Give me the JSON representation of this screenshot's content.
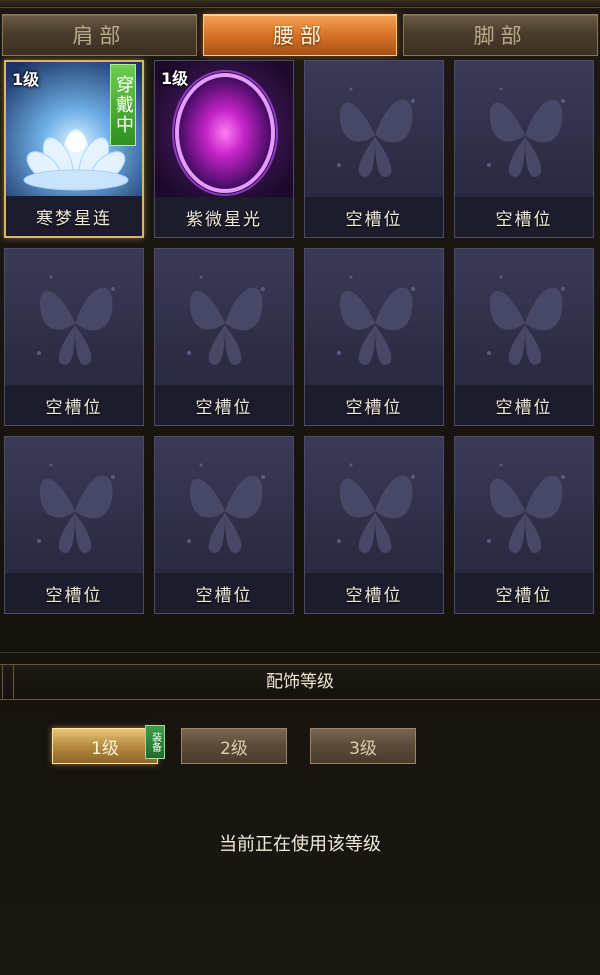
{
  "tabs": [
    {
      "label": "肩部",
      "active": false
    },
    {
      "label": "腰部",
      "active": true
    },
    {
      "label": "脚部",
      "active": false
    }
  ],
  "slots": [
    {
      "name": "寒梦星连",
      "level": "1级",
      "worn_badge": "穿戴中",
      "kind": "lotus"
    },
    {
      "name": "紫微星光",
      "level": "1级",
      "kind": "orb"
    },
    {
      "name": "空槽位",
      "kind": "empty"
    },
    {
      "name": "空槽位",
      "kind": "empty"
    },
    {
      "name": "空槽位",
      "kind": "empty"
    },
    {
      "name": "空槽位",
      "kind": "empty"
    },
    {
      "name": "空槽位",
      "kind": "empty"
    },
    {
      "name": "空槽位",
      "kind": "empty"
    },
    {
      "name": "空槽位",
      "kind": "empty"
    },
    {
      "name": "空槽位",
      "kind": "empty"
    },
    {
      "name": "空槽位",
      "kind": "empty"
    },
    {
      "name": "空槽位",
      "kind": "empty"
    }
  ],
  "level_section": {
    "title": "配饰等级",
    "buttons": [
      {
        "label": "1级",
        "active": true,
        "tag": "装备"
      },
      {
        "label": "2级",
        "active": false
      },
      {
        "label": "3级",
        "active": false
      }
    ],
    "status": "当前正在使用该等级"
  },
  "colors": {
    "accent_orange": "#d77326",
    "equipped_border": "#d9b76a",
    "worn_green": "#3f9d4b"
  },
  "icons": {
    "empty_slot": "butterfly-icon",
    "lotus": "lotus-icon",
    "orb": "purple-orb-icon"
  }
}
